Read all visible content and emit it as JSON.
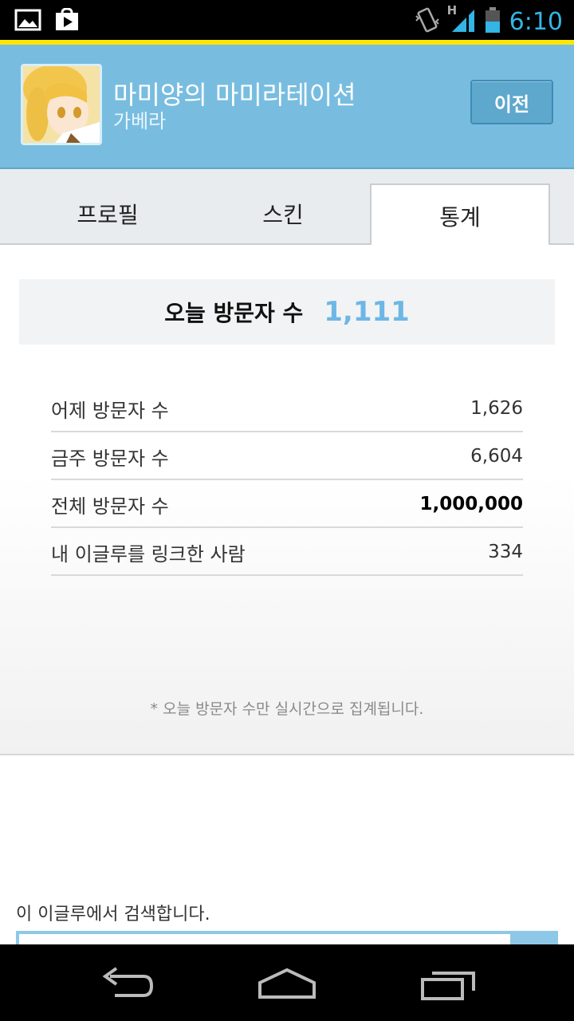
{
  "status_bar": {
    "time": "6:10",
    "network": "H",
    "icons": [
      "image-icon",
      "play-store-icon",
      "vibrate-icon",
      "signal-icon",
      "battery-icon"
    ]
  },
  "header": {
    "title": "마미양의 마미라테이션",
    "owner": "가베라",
    "prev_button": "이전"
  },
  "tabs": [
    {
      "label": "프로필",
      "active": false
    },
    {
      "label": "스킨",
      "active": false
    },
    {
      "label": "통계",
      "active": true
    }
  ],
  "stats": {
    "today_label": "오늘 방문자 수",
    "today_value": "1,111",
    "rows": [
      {
        "label": "어제 방문자 수",
        "value": "1,626"
      },
      {
        "label": "금주 방문자 수",
        "value": "6,604"
      },
      {
        "label": "전체 방문자 수",
        "value": "1,000,000"
      },
      {
        "label": "내 이글루를 링크한 사람",
        "value": "334"
      }
    ],
    "note": "* 오늘 방문자 수만 실시간으로 집계됩니다."
  },
  "search": {
    "label": "이 이글루에서 검색합니다."
  },
  "nav": {
    "icons": [
      "back-icon",
      "home-icon",
      "recent-apps-icon"
    ]
  },
  "colors": {
    "accent": "#33b5e5",
    "header_bg": "#78bde0",
    "today_value": "#6db7e6",
    "indicator": "#ffe600"
  }
}
